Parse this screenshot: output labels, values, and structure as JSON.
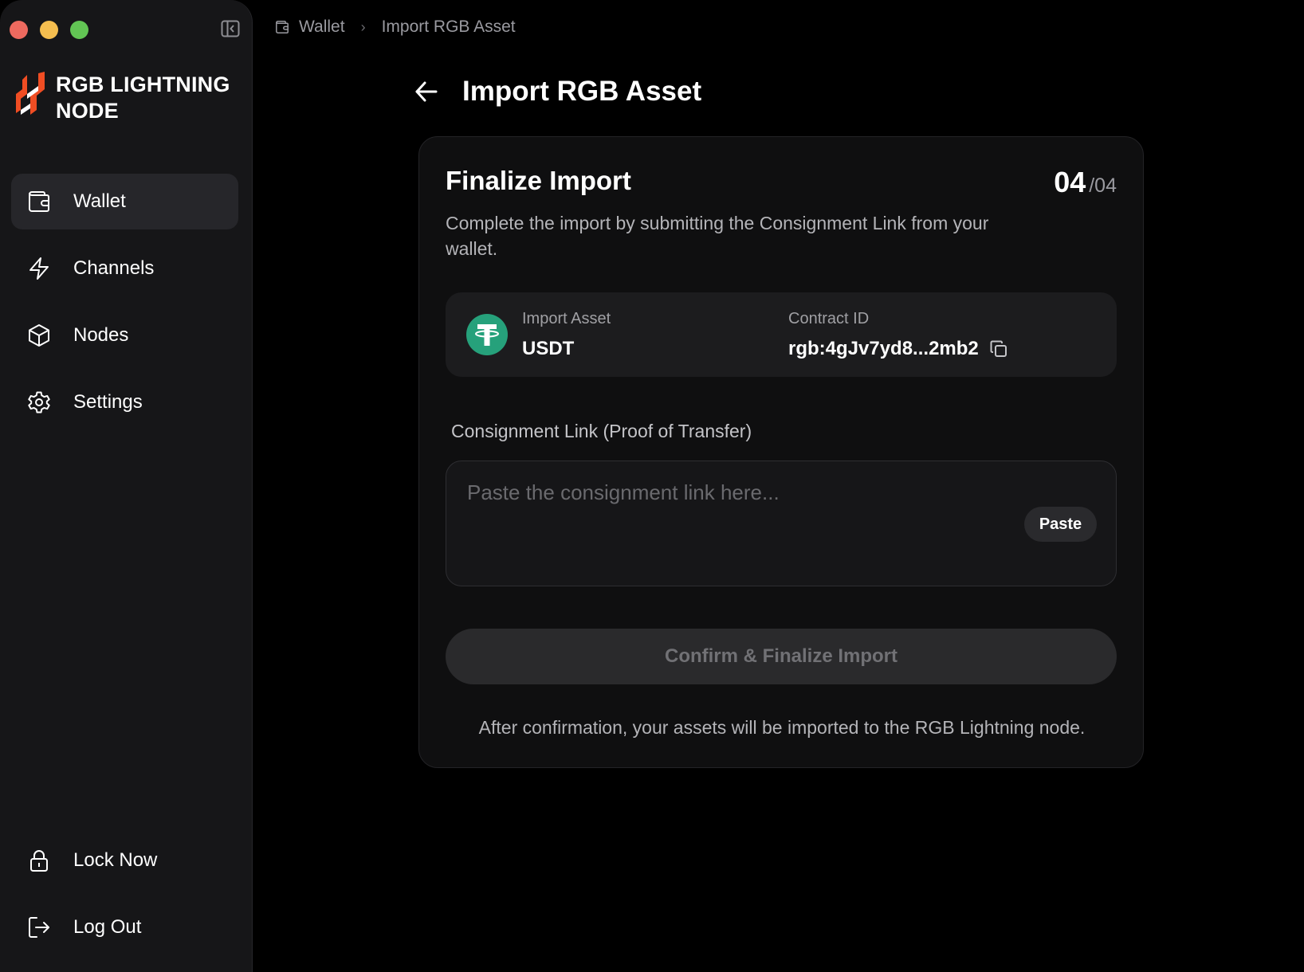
{
  "app": {
    "brand_line1": "RGB LIGHTNING",
    "brand_line2": "NODE",
    "accent_color": "#f04d23"
  },
  "sidebar": {
    "items": [
      {
        "label": "Wallet",
        "icon": "wallet-icon",
        "active": true
      },
      {
        "label": "Channels",
        "icon": "lightning-icon"
      },
      {
        "label": "Nodes",
        "icon": "cube-icon"
      },
      {
        "label": "Settings",
        "icon": "gear-icon"
      }
    ],
    "bottom_items": [
      {
        "label": "Lock Now",
        "icon": "lock-icon"
      },
      {
        "label": "Log Out",
        "icon": "logout-icon"
      }
    ]
  },
  "breadcrumb": {
    "root": "Wallet",
    "current": "Import RGB Asset"
  },
  "page": {
    "title": "Import RGB Asset"
  },
  "card": {
    "title": "Finalize Import",
    "step_current": "04",
    "step_total": "/04",
    "description": "Complete the import by submitting the Consignment Link from your wallet.",
    "asset": {
      "asset_label": "Import Asset",
      "asset_value": "USDT",
      "contract_label": "Contract ID",
      "contract_value": "rgb:4gJv7yd8...2mb2",
      "token_color": "#26a17b"
    },
    "consignment": {
      "label": "Consignment Link (Proof of Transfer)",
      "placeholder": "Paste the consignment link here...",
      "paste_label": "Paste"
    },
    "confirm_label": "Confirm & Finalize Import",
    "note": "After confirmation, your assets will be imported to the RGB Lightning node."
  }
}
